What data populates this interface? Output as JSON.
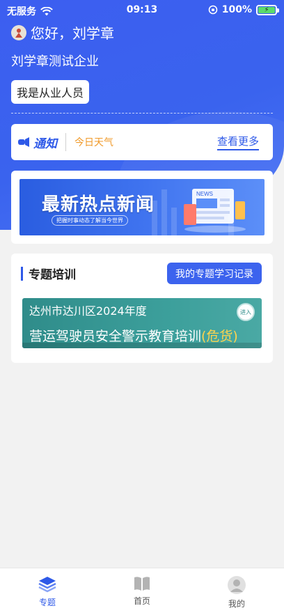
{
  "status_bar": {
    "carrier": "无服务",
    "time": "09:13",
    "battery": "100%"
  },
  "header": {
    "greeting": "您好，刘学章",
    "company": "刘学章测试企业",
    "role_button": "我是从业人员"
  },
  "notice": {
    "logo_text": "通知",
    "message": "今日天气",
    "more_link": "查看更多"
  },
  "banner": {
    "title": "最新热点新闻",
    "subtitle": "把握时事动态了解当今世界",
    "badge": "NEWS"
  },
  "training": {
    "section_title": "专题培训",
    "record_button": "我的专题学习记录",
    "course": {
      "line1": "达州市达川区2024年度",
      "line2_main": "营运驾驶员安全警示教育培训",
      "line2_highlight": "(危货)",
      "enter_label": "进入"
    }
  },
  "tabbar": {
    "items": [
      {
        "label": "专题",
        "icon": "layers-icon",
        "active": true
      },
      {
        "label": "首页",
        "icon": "book-icon",
        "active": false
      },
      {
        "label": "我的",
        "icon": "user-icon",
        "active": false
      }
    ]
  },
  "colors": {
    "primary": "#3c5ef0",
    "accent_orange": "#f09a2a",
    "course_teal": "#2f8c8a",
    "highlight_yellow": "#ffd34d"
  }
}
